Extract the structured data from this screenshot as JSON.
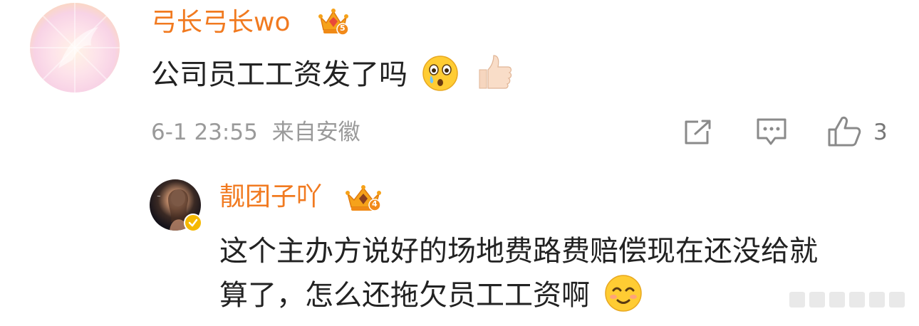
{
  "comment": {
    "username": "弓长弓长wo",
    "member_badge_level": "5",
    "text": "公司员工工资发了吗",
    "emoji_1": "astonished-tear-emoji",
    "emoji_2": "thumbs-up-emoji",
    "timestamp": "6-1 23:55",
    "location": "来自安徽",
    "like_count": "3"
  },
  "reply": {
    "username": "靓团子吖",
    "member_badge_level": "4",
    "text_line_1": "这个主办方说好的场地费路费赔偿现在还没给就",
    "text_line_2": "算了，怎么还拖欠员工工资啊",
    "emoji": "smile-emoji",
    "verified": true
  },
  "icons": [
    "share-icon",
    "comment-icon",
    "like-icon",
    "crown-badge-icon",
    "verified-badge-icon"
  ],
  "colors": {
    "username": "#f17a20",
    "body_text": "#222222",
    "meta_text": "#9a9a9a",
    "icon": "#8a8a8a",
    "verified": "#f5b800"
  }
}
